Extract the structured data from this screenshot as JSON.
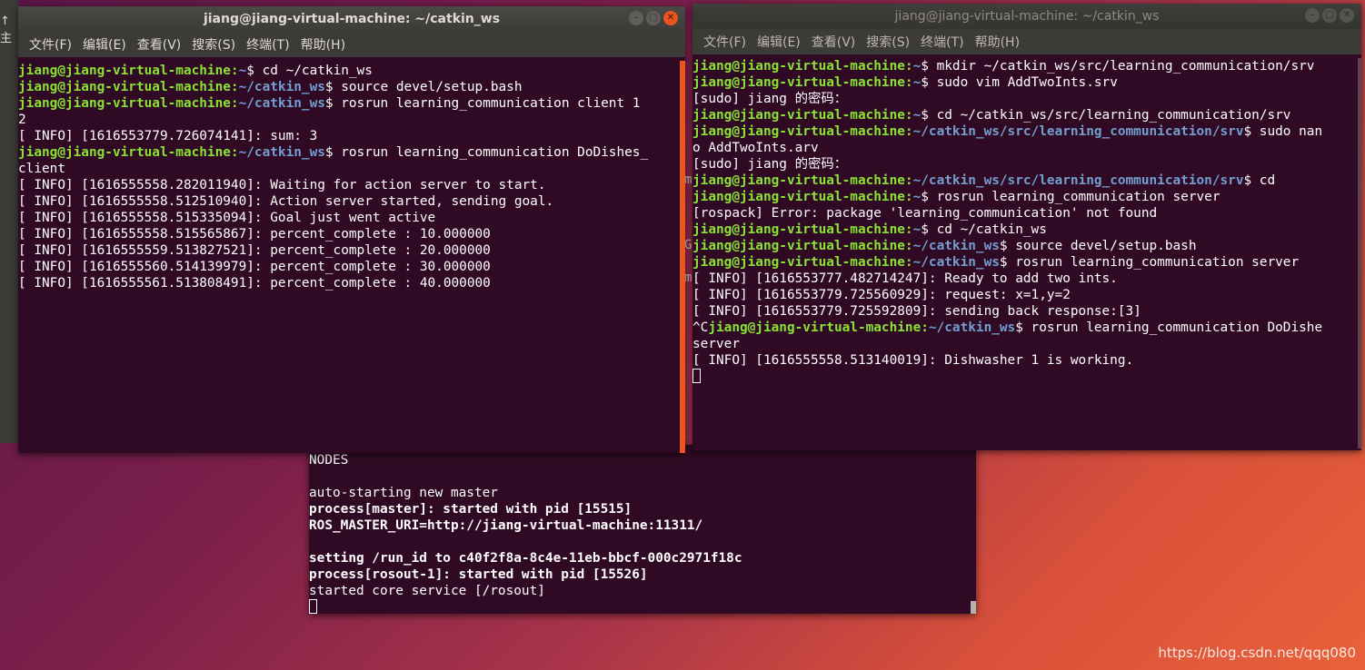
{
  "background_fragments": {
    "left_edge": "↑ 主",
    "mid_g": "G",
    "mid_m": "m",
    "mid_tick": "m"
  },
  "windows": {
    "left": {
      "title": "jiang@jiang-virtual-machine: ~/catkin_ws",
      "menu": [
        "文件(F)",
        "编辑(E)",
        "查看(V)",
        "搜索(S)",
        "终端(T)",
        "帮助(H)"
      ],
      "lines": [
        [
          "jiang@jiang-virtual-machine:",
          "~",
          "$ cd ~/catkin_ws"
        ],
        [
          "jiang@jiang-virtual-machine:",
          "~/catkin_ws",
          "$ source devel/setup.bash"
        ],
        [
          "jiang@jiang-virtual-machine:",
          "~/catkin_ws",
          "$ rosrun learning_communication client 1"
        ],
        [
          "",
          "",
          "2"
        ],
        [
          "",
          "",
          "[ INFO] [1616553779.726074141]: sum: 3"
        ],
        [
          "jiang@jiang-virtual-machine:",
          "~/catkin_ws",
          "$ rosrun learning_communication DoDishes_"
        ],
        [
          "",
          "",
          "client"
        ],
        [
          "",
          "",
          "[ INFO] [1616555558.282011940]: Waiting for action server to start."
        ],
        [
          "",
          "",
          "[ INFO] [1616555558.512510940]: Action server started, sending goal."
        ],
        [
          "",
          "",
          "[ INFO] [1616555558.515335094]: Goal just went active"
        ],
        [
          "",
          "",
          "[ INFO] [1616555558.515565867]: percent_complete : 10.000000"
        ],
        [
          "",
          "",
          "[ INFO] [1616555559.513827521]: percent_complete : 20.000000"
        ],
        [
          "",
          "",
          "[ INFO] [1616555560.514139979]: percent_complete : 30.000000"
        ],
        [
          "",
          "",
          "[ INFO] [1616555561.513808491]: percent_complete : 40.000000"
        ]
      ]
    },
    "right": {
      "title": "jiang@jiang-virtual-machine: ~/catkin_ws",
      "menu": [
        "文件(F)",
        "编辑(E)",
        "查看(V)",
        "搜索(S)",
        "终端(T)",
        "帮助(H)"
      ],
      "lines": [
        [
          "jiang@jiang-virtual-machine:",
          "~",
          "$ mkdir ~/catkin_ws/src/learning_communication/srv"
        ],
        [
          "jiang@jiang-virtual-machine:",
          "~",
          "$ sudo vim AddTwoInts.srv"
        ],
        [
          "",
          "",
          "[sudo] jiang 的密码："
        ],
        [
          "jiang@jiang-virtual-machine:",
          "~",
          "$ cd ~/catkin_ws/src/learning_communication/srv"
        ],
        [
          "jiang@jiang-virtual-machine:",
          "~/catkin_ws/src/learning_communication/srv",
          "$ sudo nan"
        ],
        [
          "",
          "",
          "o AddTwoInts.arv"
        ],
        [
          "",
          "",
          "[sudo] jiang 的密码："
        ],
        [
          "jiang@jiang-virtual-machine:",
          "~/catkin_ws/src/learning_communication/srv",
          "$ cd"
        ],
        [
          "jiang@jiang-virtual-machine:",
          "~",
          "$ rosrun learning_communication server"
        ],
        [
          "",
          "",
          "[rospack] Error: package 'learning_communication' not found"
        ],
        [
          "jiang@jiang-virtual-machine:",
          "~",
          "$ cd ~/catkin_ws"
        ],
        [
          "jiang@jiang-virtual-machine:",
          "~/catkin_ws",
          "$ source devel/setup.bash"
        ],
        [
          "jiang@jiang-virtual-machine:",
          "~/catkin_ws",
          "$ rosrun learning_communication server"
        ],
        [
          "",
          "",
          "[ INFO] [1616553777.482714247]: Ready to add two ints."
        ],
        [
          "",
          "",
          "[ INFO] [1616553779.725560929]: request: x=1,y=2"
        ],
        [
          "",
          "",
          "[ INFO] [1616553779.725592809]: sending back response:[3]"
        ],
        [
          "^C",
          "jiang@jiang-virtual-machine:|~/catkin_ws",
          "$ rosrun learning_communication DoDishe"
        ],
        [
          "",
          "",
          "server"
        ],
        [
          "",
          "",
          "[ INFO] [1616555558.513140019]: Dishwasher 1 is working."
        ]
      ]
    },
    "bottom": {
      "lines": [
        [
          "NODES",
          false
        ],
        [
          "",
          false
        ],
        [
          "auto-starting new master",
          false
        ],
        [
          "process[master]: started with pid [15515]",
          true
        ],
        [
          "ROS_MASTER_URI=http://jiang-virtual-machine:11311/",
          true
        ],
        [
          "",
          false
        ],
        [
          "setting /run_id to c40f2f8a-8c4e-11eb-bbcf-000c2971f18c",
          true
        ],
        [
          "process[rosout-1]: started with pid [15526]",
          true
        ],
        [
          "started core service [/rosout]",
          false
        ]
      ]
    }
  },
  "watermark": "https://blog.csdn.net/qqq080",
  "colors": {
    "terminal_bg": "#300a24",
    "prompt_user": "#8ae234",
    "prompt_path": "#729fcf",
    "accent": "#e95420"
  }
}
